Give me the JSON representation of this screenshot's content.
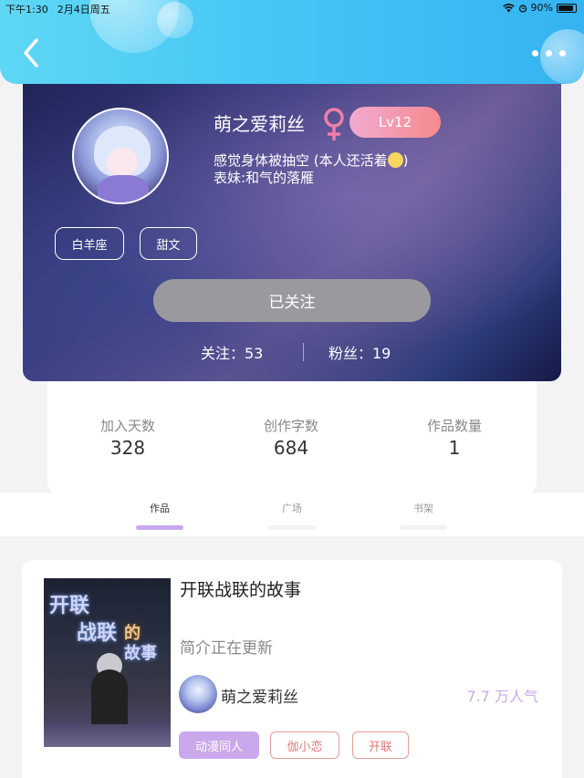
{
  "status": {
    "time": "下午1:30",
    "date": "2月4日周五",
    "battery": "90%"
  },
  "profile": {
    "name": "萌之爱莉丝",
    "level": "Lv12",
    "bio_line1": "感觉身体被抽空 (本人还活着",
    "bio_line1_end": ")",
    "bio_line2": "表妹:和气的落雁",
    "tags": [
      "白羊座",
      "甜文"
    ],
    "follow_button": "已关注",
    "following_label": "关注：53",
    "fans_label": "粉丝：19"
  },
  "stats": [
    {
      "label": "加入天数",
      "value": "328"
    },
    {
      "label": "创作字数",
      "value": "684"
    },
    {
      "label": "作品数量",
      "value": "1"
    }
  ],
  "tabs": [
    "作品",
    "广场",
    "书架"
  ],
  "active_tab": "作品",
  "work": {
    "cover_text": [
      "开联",
      "战联",
      "的",
      "故事"
    ],
    "title": "开联战联的故事",
    "description": "简介正在更新",
    "author": "萌之爱莉丝",
    "popularity": "7.7 万人气",
    "tags": [
      "动漫同人",
      "伽小恋",
      "开联"
    ]
  },
  "colors": {
    "header": "#43c5f4",
    "level_badge": "#f58a8e",
    "active_tab": "#c6a8ee",
    "popularity": "#c9a9ef",
    "genre_filled": "#c9a8ec",
    "genre_outline": "#e89a9a"
  }
}
